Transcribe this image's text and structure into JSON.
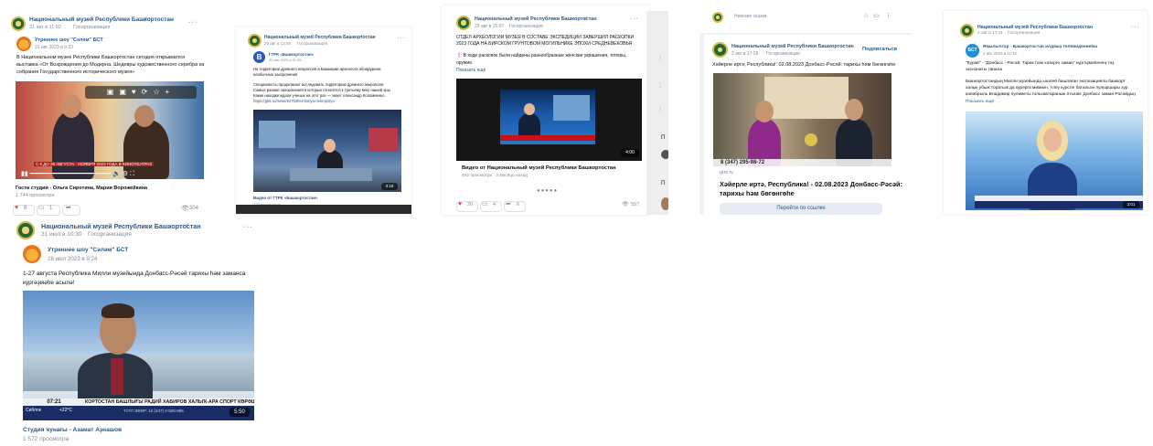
{
  "common": {
    "museum": "Национальный музей Республики Башкортостан",
    "gosorg": "Госорганизация",
    "dots": "···",
    "check": "✓"
  },
  "p1": {
    "date": "31 авг в 11:02",
    "repost_name": "Утреннее шоу \"Сәләм\" БСТ",
    "repost_date": "31 авг 2023 в 9:23",
    "text1": "В Национальном музее Республики Башкортостан сегодня открывается",
    "text2": "выставка «От Возрождения до Модерна. Шедевры художественного серебра из",
    "text3": "собрания Государственного исторического музея»",
    "video_ticker": "С 8 ДО 29 АВГУСТА · НОЯБРЯ 2023 ГОДА В КИНОТЕАТРАХ",
    "guests": "Гости студии - Ольга Сиротина, Мария Ворожейкина",
    "views": "1 744 просмотра",
    "likes": "8",
    "comments": "1",
    "view_count": "304"
  },
  "p2": {
    "date": "29 авг в 13:46",
    "repost_name": "ГТРК «Башкортостан»",
    "repost_date": "29 авг 2023 в 11:06",
    "text1": "На территории древнего некрополя в Башкирии археологи обнаружили",
    "text2": "необычные захоронения",
    "text3": "Специалисты продолжают исследовать территорию древнего некрополя.",
    "text4": "Самые ранние захоронения в которых относятся к третьему веку нашей эры.",
    "text5": "Какие находки ждали ученых на этот раз — знает Александр Коломиенко.",
    "url": "https://gtrk.ru/news/82763/territoriya-nekropolya",
    "duration": "3:18",
    "caption": "Видео от ГТРК «Башкортостан»",
    "caption_views": "225 просмотров"
  },
  "p3": {
    "date": "29 авг в 15:07",
    "title1": "ОТДЕЛ АРХЕОЛОГИИ МУЗЕЯ В СОСТАВЕ ЭКСПЕДИЦИИ ЗАВЕРШИЛ РАСКОПКИ",
    "title2": "2023 ГОДА НА БИРСКОМ ГРУНТОВОМ МОГИЛЬНИКЕ ЭПОХИ СРЕДНЕВЕКОВЬЯ",
    "text1": "❗ В ходе раскопок были найдены разнообразные женские украшения, топоры,",
    "text2": "оружие.",
    "more": "Показать ещё",
    "duration": "4:00",
    "video_title": "Видео от Национальный музей Республики Башкортостан",
    "video_views": "642 просмотра · 3 месяца назад",
    "likes": "20",
    "comments": "4",
    "shares": "6",
    "view_count": "557"
  },
  "p4": {
    "top_text": "Невские сказки.",
    "date": "2 авг в 17:26",
    "subscribe": "Подписаться",
    "text": "Хәйерле иртә, Республика!: 02.08.2023 Донбасс-Рәсәй: тарихы һәм бөгөнгөһе",
    "ticker": "8 (347) 295-98-72",
    "domain": "gtrk.tv",
    "link_title1": "Хәйерле иртә, Республика! - 02.08.2023 Донбасс-Рәсәй:",
    "link_title2": "тарихы һәм бөгөнгөһе",
    "open_link": "Перейти по ссылке"
  },
  "p5": {
    "date": "2 авг в 17:11",
    "repost_name": "Яңылыҡтар - Башкортостан илдәшҙ телевидениеһы",
    "repost_date": "2 авг 2023 в 11:10",
    "text1": "\"Курай\" - \"Донбасс - Рәсәй. Тарих һәм хәзерге заман\" күргәҙмәһенең тәҙ",
    "text2": "экспонаты танала",
    "text3": "Башкортостандың Милли музейында ышлей башлаған экспозицияла башкорт",
    "text4": "халык убыж торатыж да курерга мөмкин. Үлеу курсле батальон пулыршары зур",
    "text5": "капибрыль Владимир пулиметы гольхавтараныж ятыгай. Донбасс заман Рәсәйдың",
    "more": "Показать ещё",
    "duration": "2:01"
  },
  "p6": {
    "date": "31 июл в 10:30",
    "repost_name": "Утреннее шоу \"Сәләм\" БСТ",
    "repost_date": "28 июл 2023 в 9:24",
    "text1": "1-27 августа Республика Милли музейында Донбасс-Рәсәй тарихы һәм заманса",
    "text2": "күргәҙмәһе асылә!",
    "clock": "07:21",
    "weather": "Сиблок",
    "temp": "+22°С",
    "ticker": "КОРТОСТАН БАШЛЫҒЫ РАДИЙ ХАБИРОВ ХАЛЫҠ-АРА СПОРТ КӨРӘШЕ УЗҒАН ТЕ",
    "phone": "ТУГЛ ЭФИР: 10 (347) 2-925-965",
    "duration": "5:50",
    "caption": "Студия ҡунағы - Азамат Аҙнашов",
    "views": "1 572 просмотра"
  }
}
